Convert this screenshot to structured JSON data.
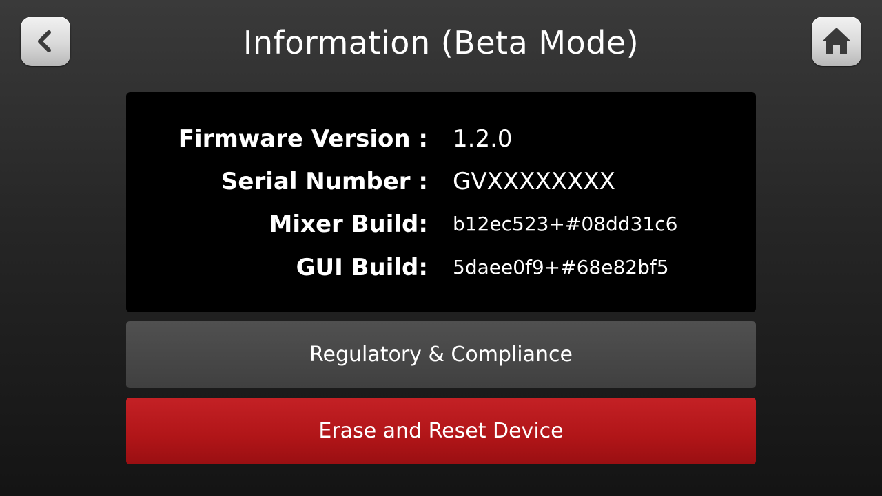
{
  "header": {
    "title": "Information (Beta Mode)",
    "back_icon": "chevron-left-icon",
    "home_icon": "home-icon"
  },
  "info": {
    "rows": [
      {
        "label": "Firmware Version :",
        "value": "1.2.0"
      },
      {
        "label": "Serial Number :",
        "value": "GVXXXXXXXX"
      },
      {
        "label": "Mixer Build:",
        "value": "b12ec523+#08dd31c6"
      },
      {
        "label": "GUI Build:",
        "value": "5daee0f9+#68e82bf5"
      }
    ]
  },
  "actions": {
    "regulatory_label": "Regulatory & Compliance",
    "erase_label": "Erase and Reset Device"
  },
  "colors": {
    "erase_button": "#b01518",
    "regulatory_button": "#484848",
    "panel": "#000000",
    "icon_glyph": "#3a3a3a"
  }
}
